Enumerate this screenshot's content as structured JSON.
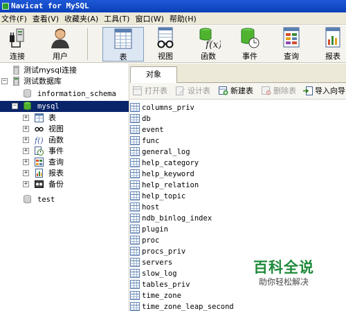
{
  "window": {
    "title": "Navicat for MySQL"
  },
  "menu": [
    "文件(F)",
    "查看(V)",
    "收藏夹(A)",
    "工具(T)",
    "窗口(W)",
    "帮助(H)"
  ],
  "toolbar": {
    "connect": "连接",
    "user": "用户",
    "table": "表",
    "view": "视图",
    "function": "函数",
    "event": "事件",
    "query": "查询",
    "report": "报表"
  },
  "tree": {
    "conn1": "测试mysql连接",
    "conn2": "测试数据库",
    "db_info": "information_schema",
    "db_mysql": "mysql",
    "children": [
      "表",
      "视图",
      "函数",
      "事件",
      "查询",
      "报表",
      "备份"
    ],
    "db_test": "test"
  },
  "tab": {
    "objects": "对象"
  },
  "objbar": {
    "open": "打开表",
    "design": "设计表",
    "new": "新建表",
    "delete": "删除表",
    "import": "导入向导"
  },
  "tables": [
    "columns_priv",
    "db",
    "event",
    "func",
    "general_log",
    "help_category",
    "help_keyword",
    "help_relation",
    "help_topic",
    "host",
    "ndb_binlog_index",
    "plugin",
    "proc",
    "procs_priv",
    "servers",
    "slow_log",
    "tables_priv",
    "time_zone",
    "time_zone_leap_second"
  ],
  "watermark": {
    "main": "百科全说",
    "sub": "助你轻松解决"
  },
  "colors": {
    "selected": "#0a246a",
    "titlebar": "#0a3fb9",
    "brand_green": "#1f8a3a"
  }
}
